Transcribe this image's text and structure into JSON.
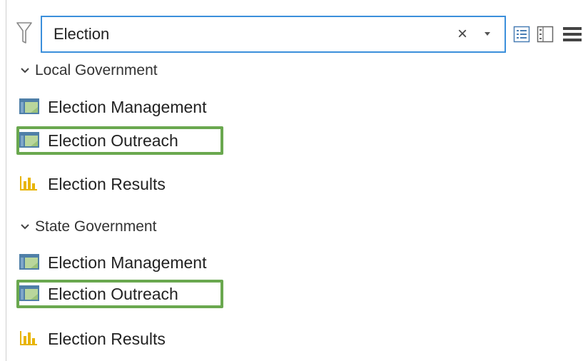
{
  "search": {
    "value": "Election",
    "clear_glyph": "×"
  },
  "icons": {
    "filter": "filter-icon",
    "clear": "close-icon",
    "dropdown": "chevron-down-icon",
    "list_view": "list-view-icon",
    "detail_view": "detail-view-icon",
    "menu": "hamburger-menu-icon",
    "map_item": "map-icon",
    "dashboard_item": "bar-chart-icon"
  },
  "colors": {
    "search_border": "#3b8fdb",
    "highlight_border": "#6aa84f",
    "map_icon_blue": "#4f7fa8",
    "map_icon_green": "#9bc27a",
    "chart_icon_yellow": "#e8b400"
  },
  "groups": [
    {
      "label": "Local Government",
      "items": [
        {
          "label": "Election Management",
          "type": "map",
          "highlighted": false
        },
        {
          "label": "Election Outreach",
          "type": "map",
          "highlighted": true
        },
        {
          "label": "Election Results",
          "type": "dashboard",
          "highlighted": false
        }
      ]
    },
    {
      "label": "State Government",
      "items": [
        {
          "label": "Election Management",
          "type": "map",
          "highlighted": false
        },
        {
          "label": "Election Outreach",
          "type": "map",
          "highlighted": true
        },
        {
          "label": "Election Results",
          "type": "dashboard",
          "highlighted": false
        }
      ]
    }
  ]
}
